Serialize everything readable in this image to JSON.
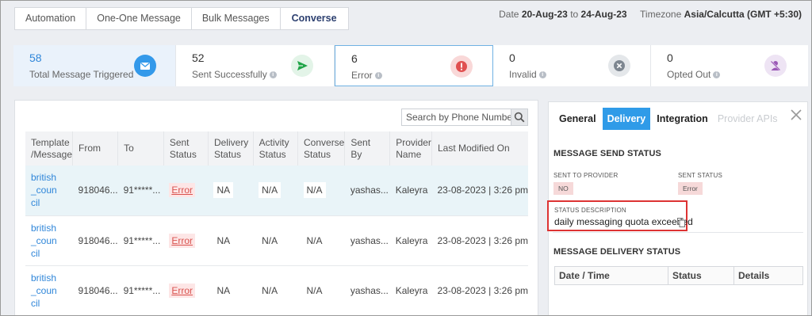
{
  "tabs": [
    {
      "label": "Automation"
    },
    {
      "label": "One-One Message"
    },
    {
      "label": "Bulk Messages"
    },
    {
      "label": "Converse"
    }
  ],
  "daterange": {
    "prefix": "Date",
    "from": "20-Aug-23",
    "sep": "to",
    "to": "24-Aug-23",
    "tz_label": "Timezone",
    "tz_value": "Asia/Calcutta (GMT +5:30)"
  },
  "stats": [
    {
      "value": "58",
      "label": "Total Message Triggered",
      "icon": "envelope-icon"
    },
    {
      "value": "52",
      "label": "Sent Successfully",
      "icon": "send-icon"
    },
    {
      "value": "6",
      "label": "Error",
      "icon": "error-icon"
    },
    {
      "value": "0",
      "label": "Invalid",
      "icon": "invalid-icon"
    },
    {
      "value": "0",
      "label": "Opted Out",
      "icon": "opted-out-icon"
    }
  ],
  "search": {
    "placeholder": "Search by Phone Number c"
  },
  "table": {
    "headers": [
      [
        "Template",
        "/Message"
      ],
      [
        "From"
      ],
      [
        "To"
      ],
      [
        "Sent",
        "Status"
      ],
      [
        "Delivery",
        "Status"
      ],
      [
        "Activity",
        "Status"
      ],
      [
        "Converse",
        "Status"
      ],
      [
        "Sent",
        "By"
      ],
      [
        "Provider",
        "Name"
      ],
      [
        "Last Modified On"
      ]
    ],
    "rows": [
      {
        "template": [
          "british",
          "_coun",
          "cil"
        ],
        "from": "918046...",
        "to": "91*****...",
        "sent": "Error",
        "delivery": "NA",
        "activity": "N/A",
        "converse": "N/A",
        "sentby": "yashas...",
        "provider": "Kaleyra",
        "modified": "23-08-2023 | 3:26 pm"
      },
      {
        "template": [
          "british",
          "_coun",
          "cil"
        ],
        "from": "918046...",
        "to": "91*****...",
        "sent": "Error",
        "delivery": "NA",
        "activity": "N/A",
        "converse": "N/A",
        "sentby": "yashas...",
        "provider": "Kaleyra",
        "modified": "23-08-2023 | 3:26 pm"
      },
      {
        "template": [
          "british",
          "_coun",
          "cil"
        ],
        "from": "918046...",
        "to": "91*****...",
        "sent": "Error",
        "delivery": "NA",
        "activity": "N/A",
        "converse": "N/A",
        "sentby": "yashas...",
        "provider": "Kaleyra",
        "modified": "23-08-2023 | 3:26 pm"
      }
    ]
  },
  "detail": {
    "tabs": [
      {
        "label": "General",
        "state": "normal"
      },
      {
        "label": "Delivery",
        "state": "active"
      },
      {
        "label": "Integration",
        "state": "normal"
      },
      {
        "label": "Provider APIs",
        "state": "disabled"
      }
    ],
    "send_status_title": "MESSAGE SEND STATUS",
    "sent_to_provider_label": "SENT TO PROVIDER",
    "sent_to_provider_value": "NO",
    "sent_status_label": "SENT STATUS",
    "sent_status_value": "Error",
    "status_desc_label": "STATUS DESCRIPTION",
    "status_desc_value": "daily messaging quota exceeded",
    "delivery_status_title": "MESSAGE DELIVERY STATUS",
    "delivery_headers": [
      "Date / Time",
      "Status",
      "Details"
    ]
  }
}
